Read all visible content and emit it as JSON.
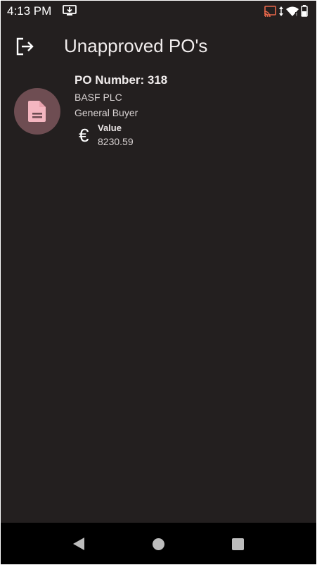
{
  "status_bar": {
    "time": "4:13 PM",
    "icons": [
      "download-icon",
      "cast-icon",
      "data-arrows-icon",
      "wifi-icon",
      "battery-icon"
    ]
  },
  "app_bar": {
    "title": "Unapproved PO's",
    "leading_icon": "logout-icon"
  },
  "purchase_orders": [
    {
      "po_number": "PO Number: 318",
      "supplier": "BASF PLC",
      "buyer": "General Buyer",
      "currency_symbol": "€",
      "value_label": "Value",
      "value": "8230.59",
      "icon": "document-icon"
    }
  ],
  "colors": {
    "background": "#231f1f",
    "avatar": "#6e4d52",
    "document_icon": "#f4b6c0",
    "cast_accent": "#e8674a",
    "nav_bar": "#000000"
  },
  "nav_bar": {
    "icons": [
      "back-icon",
      "home-icon",
      "recents-icon"
    ]
  }
}
